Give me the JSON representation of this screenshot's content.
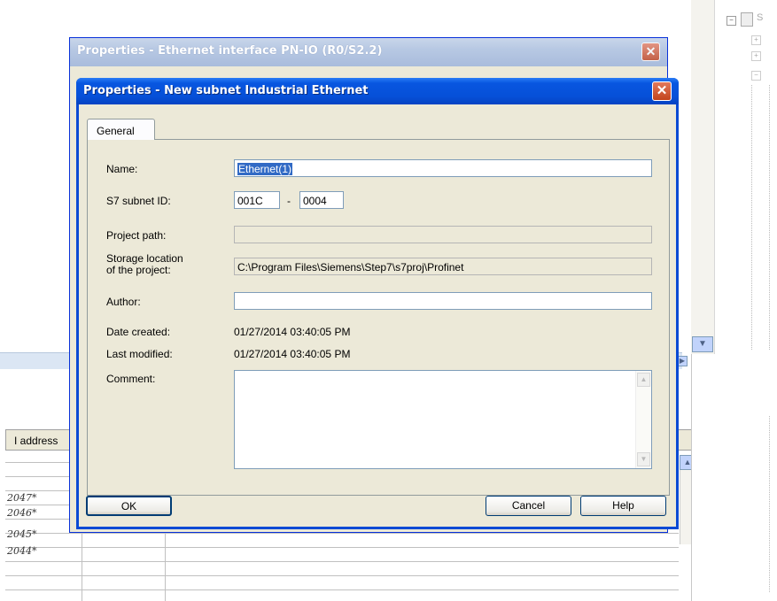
{
  "background": {
    "table_column_header": "I address",
    "table_rows": [
      "2047*",
      "2046*",
      "2045*",
      "2044*"
    ],
    "right_panel_first_label": "S"
  },
  "back_dialog": {
    "title": "Properties - Ethernet interface  PN-IO (R0/S2.2)",
    "close_glyph": "✕"
  },
  "dialog": {
    "title": "Properties -  New subnet Industrial Ethernet",
    "close_glyph": "✕",
    "tabs": [
      {
        "label": "General"
      }
    ],
    "fields": {
      "name": {
        "label": "Name:",
        "value": "Ethernet(1)"
      },
      "subnet_id": {
        "label": "S7 subnet ID:",
        "value1": "001C",
        "separator": "-",
        "value2": "0004"
      },
      "project_path": {
        "label": "Project path:",
        "value": ""
      },
      "storage_location": {
        "label_line1": "Storage location",
        "label_line2": "of the project:",
        "value": "C:\\Program Files\\Siemens\\Step7\\s7proj\\Profinet"
      },
      "author": {
        "label": "Author:",
        "value": ""
      },
      "date_created": {
        "label": "Date created:",
        "value": "01/27/2014 03:40:05 PM"
      },
      "last_modified": {
        "label": "Last modified:",
        "value": "01/27/2014 03:40:05 PM"
      },
      "comment": {
        "label": "Comment:",
        "value": ""
      }
    },
    "buttons": {
      "ok": "OK",
      "cancel": "Cancel",
      "help": "Help"
    }
  },
  "colors": {
    "titlebar": "#0650d8",
    "dialog_face": "#ece9d8",
    "selection": "#316ac5",
    "close_button": "#c3441d"
  }
}
